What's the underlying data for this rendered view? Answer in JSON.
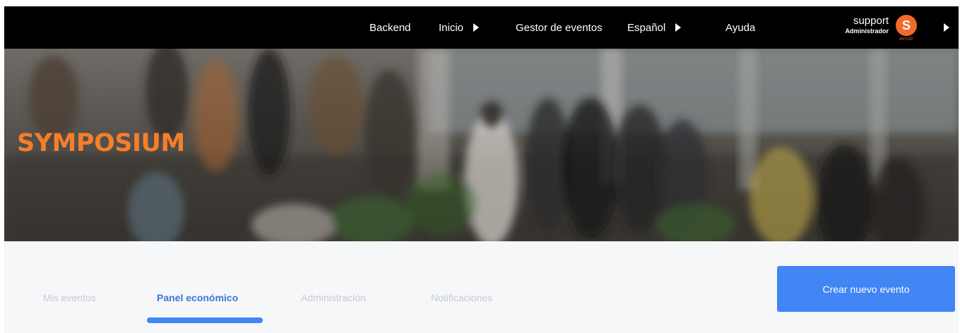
{
  "nav": {
    "backend": "Backend",
    "inicio": "Inicio",
    "gestor": "Gestor de eventos",
    "language": "Español",
    "ayuda": "Ayuda"
  },
  "user": {
    "name": "support",
    "role": "Administrador",
    "avatar_letter": "S",
    "avatar_tag": "MPOSP"
  },
  "hero": {
    "brand": "SYMPOSIUM"
  },
  "tabs": [
    {
      "label": "Mis eventos",
      "active": false
    },
    {
      "label": "Panel económico",
      "active": true
    },
    {
      "label": "Administración",
      "active": false
    },
    {
      "label": "Notificaciones",
      "active": false
    }
  ],
  "actions": {
    "create_event": "Crear nuevo evento"
  },
  "colors": {
    "topbar": "#000000",
    "brand": "#f57e2b",
    "accent": "#4285f4",
    "tab_inactive": "#c6cad1",
    "tab_active": "#3a78d6"
  }
}
